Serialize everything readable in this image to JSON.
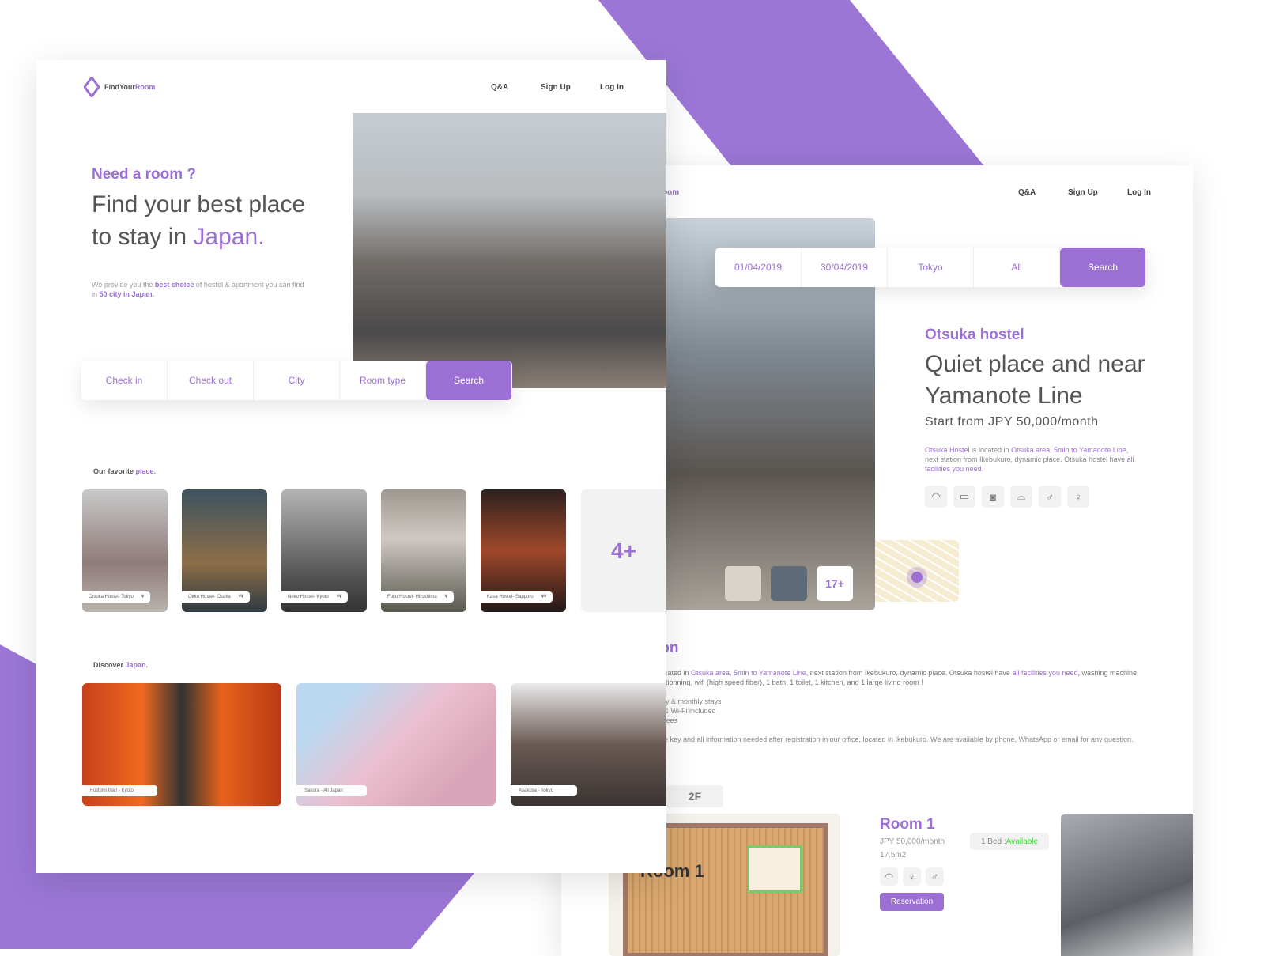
{
  "left": {
    "logo": {
      "a": "FindYour",
      "b": "Room"
    },
    "nav": [
      "Q&A",
      "Sign Up",
      "Log In"
    ],
    "hero": {
      "kicker": "Need a room ?",
      "title1": "Find your best place",
      "title2a": "to stay in ",
      "title2b": "Japan.",
      "desc": {
        "a": "We provide you the ",
        "b": "best choice",
        "c": " of hostel & apartment you can find in ",
        "d": "50 city in Japan."
      }
    },
    "search": [
      "Check in",
      "Check out",
      "City",
      "Room type",
      "Search"
    ],
    "favorites": {
      "title_a": "Our favorite ",
      "title_b": "place.",
      "items": [
        {
          "name": "Otsuka Hostel- Tokyo",
          "price": "¥"
        },
        {
          "name": "Okko Hostel- Osaka",
          "price": "¥¥"
        },
        {
          "name": "Neko Hostel- Kyoto",
          "price": "¥¥"
        },
        {
          "name": "Fuku Hostel- Hiroshima",
          "price": "¥"
        },
        {
          "name": "Kasa Hostel- Sapporo",
          "price": "¥¥"
        }
      ],
      "more": "4+"
    },
    "discover": {
      "title_a": "Discover ",
      "title_b": "Japan.",
      "items": [
        "Fushimi Inari - Kyoto",
        "Sakura - All Japan",
        "Asakusa - Tokyo"
      ]
    }
  },
  "right": {
    "logo_partial": "oom",
    "nav": [
      "Q&A",
      "Sign Up",
      "Log In"
    ],
    "search": [
      "01/04/2019",
      "30/04/2019",
      "Tokyo",
      "All",
      "Search"
    ],
    "hostel": {
      "name": "Otsuka hostel",
      "title1": "Quiet place and near",
      "title2": "Yamanote Line",
      "price": "Start from JPY 50,000/month",
      "desc": {
        "a": "Otsuka Hostel",
        "b": " is located in ",
        "c": "Otsuka area, 5min to Yamanote Line",
        "d": ", next station from Ikebukuro, dynamic place. Otsuka hostel have ",
        "e": "all facilities you need."
      },
      "photos_more": "17+"
    },
    "section_title": "ion",
    "section_text": {
      "a": "cated in ",
      "b": "Otsuka area, 5min to Yamanote Line",
      "c": ", next station from Ikebukuro, dynamic place. Otsuka hostel have ",
      "d": "all facilities you need",
      "e": ", washing machine,",
      "f": "itionning, wifi (high speed fiber), 1 bath, 1 toilet, 1 kitchen, and 1 large living room !"
    },
    "features": [
      "ly & monthly stays",
      "& Wi-Fi included",
      "fees"
    ],
    "contact": "e key and all information needed after registration in our office, located in Ikebukuro. We are available by phone, WhatsApp or email for any question.",
    "floor": "2F",
    "plan_label": "Room 1",
    "room": {
      "name": "Room 1",
      "price": "JPY 50,000/month",
      "size": "17.5m2",
      "bed": "1 Bed : ",
      "status": "Available",
      "button": "Reservation"
    }
  },
  "colors": {
    "accent": "#9b6fd4",
    "available": "#3ddc3d"
  }
}
